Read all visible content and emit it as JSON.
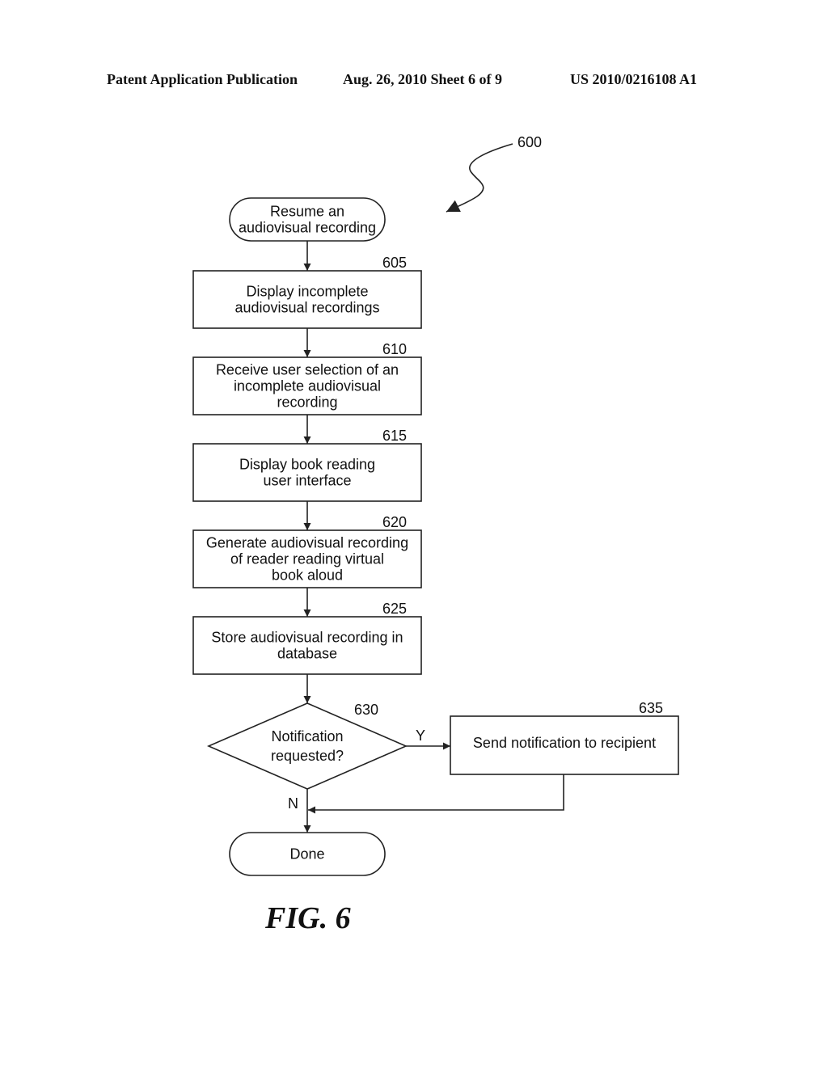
{
  "header": {
    "left": "Patent Application Publication",
    "middle": "Aug. 26, 2010  Sheet 6 of 9",
    "right": "US 2010/0216108 A1"
  },
  "figure": {
    "reference": "600",
    "caption": "FIG. 6"
  },
  "nodes": [
    {
      "id": "start",
      "type": "terminal",
      "ref": "",
      "lines": [
        "Resume an",
        "audiovisual recording"
      ]
    },
    {
      "id": "605",
      "type": "process",
      "ref": "605",
      "lines": [
        "Display incomplete",
        "audiovisual recordings"
      ]
    },
    {
      "id": "610",
      "type": "process",
      "ref": "610",
      "lines": [
        "Receive user selection of an",
        "incomplete audiovisual",
        "recording"
      ]
    },
    {
      "id": "615",
      "type": "process",
      "ref": "615",
      "lines": [
        "Display book reading",
        "user interface"
      ]
    },
    {
      "id": "620",
      "type": "process",
      "ref": "620",
      "lines": [
        "Generate audiovisual recording",
        "of reader reading virtual",
        "book aloud"
      ]
    },
    {
      "id": "625",
      "type": "process",
      "ref": "625",
      "lines": [
        "Store audiovisual recording in",
        "database"
      ]
    },
    {
      "id": "630",
      "type": "decision",
      "ref": "630",
      "lines": [
        "Notification",
        "requested?"
      ]
    },
    {
      "id": "635",
      "type": "process",
      "ref": "635",
      "lines": [
        "Send notification to recipient"
      ]
    },
    {
      "id": "done",
      "type": "terminal",
      "ref": "",
      "lines": [
        "Done"
      ]
    }
  ],
  "edges": [
    {
      "from": "start",
      "to": "605",
      "label": ""
    },
    {
      "from": "605",
      "to": "610",
      "label": ""
    },
    {
      "from": "610",
      "to": "615",
      "label": ""
    },
    {
      "from": "615",
      "to": "620",
      "label": ""
    },
    {
      "from": "620",
      "to": "625",
      "label": ""
    },
    {
      "from": "625",
      "to": "630",
      "label": ""
    },
    {
      "from": "630",
      "to": "635",
      "label": "Y"
    },
    {
      "from": "630",
      "to": "done",
      "label": "N"
    },
    {
      "from": "635",
      "to": "done",
      "label": ""
    }
  ]
}
